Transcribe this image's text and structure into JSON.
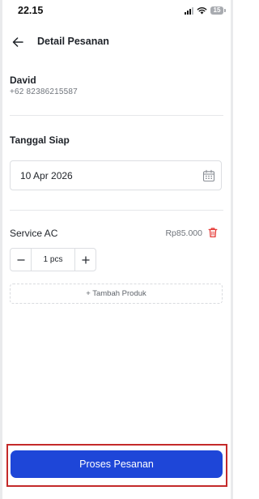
{
  "status_bar": {
    "time": "22.15",
    "battery_level": "15"
  },
  "header": {
    "title": "Detail Pesanan",
    "back_icon": "arrow-left-icon"
  },
  "customer": {
    "name": "David",
    "phone": "+62 82386215587"
  },
  "ready_date": {
    "section_title": "Tanggal Siap",
    "value": "10 Apr 2026",
    "icon": "calendar-icon"
  },
  "products": [
    {
      "name": "Service AC",
      "price": "Rp85.000",
      "quantity": "1 pcs"
    }
  ],
  "add_product_label": "+ Tambah Produk",
  "submit_label": "Proses Pesanan",
  "colors": {
    "primary": "#1e46d8",
    "danger": "#e53935",
    "highlight": "#c42a2a"
  }
}
